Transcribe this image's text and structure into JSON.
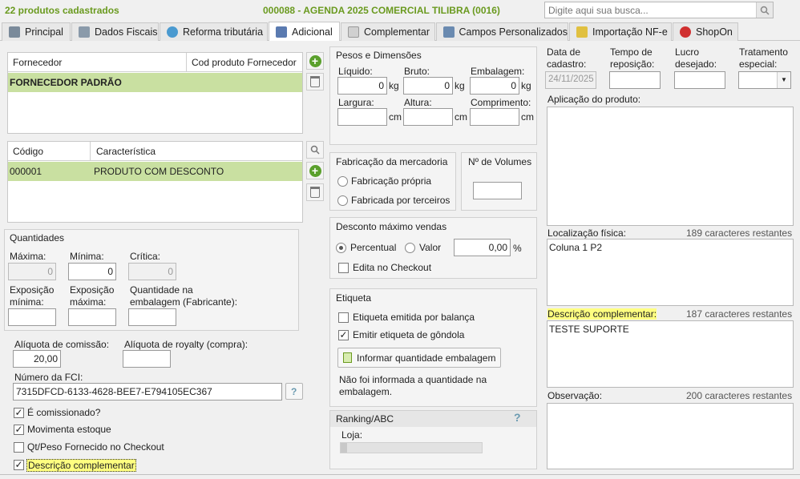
{
  "header": {
    "count": "22 produtos cadastrados",
    "title": "000088 - AGENDA 2025 COMERCIAL TILIBRA (0016)",
    "search_placeholder": "Digite aqui sua busca..."
  },
  "tabs": [
    "Principal",
    "Dados Fiscais",
    "Reforma tributária",
    "Adicional",
    "Complementar",
    "Campos Personalizados",
    "Importação NF-e",
    "ShopOn"
  ],
  "supplier": {
    "col1": "Fornecedor",
    "col2": "Cod produto Fornecedor",
    "row": "FORNECEDOR PADRÃO"
  },
  "characteristics": {
    "col1": "Código",
    "col2": "Característica",
    "code": "000001",
    "desc": "PRODUTO COM DESCONTO"
  },
  "quantities": {
    "title": "Quantidades",
    "max": "Máxima:",
    "max_val": "0",
    "min": "Mínima:",
    "min_val": "0",
    "crit": "Crítica:",
    "crit_val": "0",
    "exp_min": "Exposição mínima:",
    "exp_max": "Exposição máxima:",
    "pack_qty": "Quantidade na embalagem (Fabricante):"
  },
  "commission": {
    "label": "Alíquota de comissão:",
    "value": "20,00",
    "royalty": "Alíquota de royalty (compra):"
  },
  "fci": {
    "label": "Número da FCI:",
    "value": "7315DFCD-6133-4628-BEE7-E794105EC367",
    "help": "?"
  },
  "checks": [
    {
      "label": "É comissionado?",
      "checked": true
    },
    {
      "label": "Movimenta estoque",
      "checked": true
    },
    {
      "label": "Qt/Peso Fornecido no Checkout",
      "checked": false
    },
    {
      "label": "Descrição complementar",
      "checked": true
    }
  ],
  "weights": {
    "title": "Pesos e Dimensões",
    "liquid": "Líquido:",
    "liquid_val": "0",
    "gross": "Bruto:",
    "gross_val": "0",
    "pack": "Embalagem:",
    "pack_val": "0",
    "kg": "kg",
    "width": "Largura:",
    "height": "Altura:",
    "length": "Comprimento:",
    "cm": "cm"
  },
  "fabrication": {
    "title": "Fabricação da mercadoria",
    "own": "Fabricação própria",
    "third": "Fabricada por terceiros"
  },
  "volumes": {
    "title": "Nº de Volumes"
  },
  "discount": {
    "title": "Desconto máximo vendas",
    "percent": "Percentual",
    "value": "Valor",
    "amount": "0,00",
    "pct": "%",
    "checkout": "Edita no Checkout"
  },
  "label": {
    "title": "Etiqueta",
    "scale": "Etiqueta emitida por balança",
    "gondola": "Emitir etiqueta de gôndola",
    "btn": "Informar quantidade embalagem",
    "msg": "Não foi informada a quantidade na embalagem."
  },
  "ranking": {
    "title": "Ranking/ABC",
    "help": "?",
    "store": "Loja:"
  },
  "right": {
    "reg_date": "Data de cadastro:",
    "reg_val": "24/11/2025",
    "repo": "Tempo de reposição:",
    "profit": "Lucro desejado:",
    "special": "Tratamento especial:",
    "application": "Aplicação do produto:",
    "location": "Localização física:",
    "location_rem": "189 caracteres restantes",
    "location_val": "Coluna 1 P2",
    "compl": "Descrição complementar:",
    "compl_rem": "187 caracteres restantes",
    "compl_val": "TESTE SUPORTE",
    "obs": "Observação:",
    "obs_rem": "200 caracteres restantes"
  }
}
